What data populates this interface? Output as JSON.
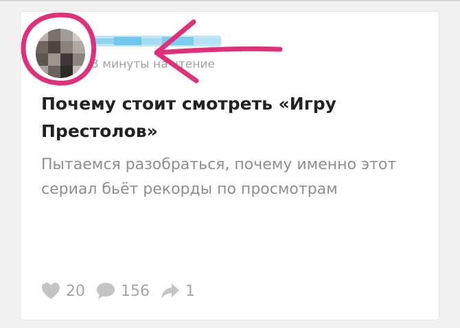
{
  "colors": {
    "annotation": "#e0307a",
    "author_blur": "#6ec8ec",
    "meta_text": "#a3a3a3",
    "title_text": "#222222",
    "excerpt_text": "#8f8f8f"
  },
  "post": {
    "read_time": "3 минуты на чтение",
    "title": "Почему стоит смотреть «Игру Престолов»",
    "excerpt": "Пытаемся разобраться, почему именно этот сериал бьёт рекорды по просмотрам"
  },
  "stats": {
    "likes": "20",
    "comments": "156",
    "shares": "1"
  },
  "icons": {
    "likes": "heart-icon",
    "comments": "speech-bubble-icon",
    "shares": "share-arrow-icon"
  }
}
